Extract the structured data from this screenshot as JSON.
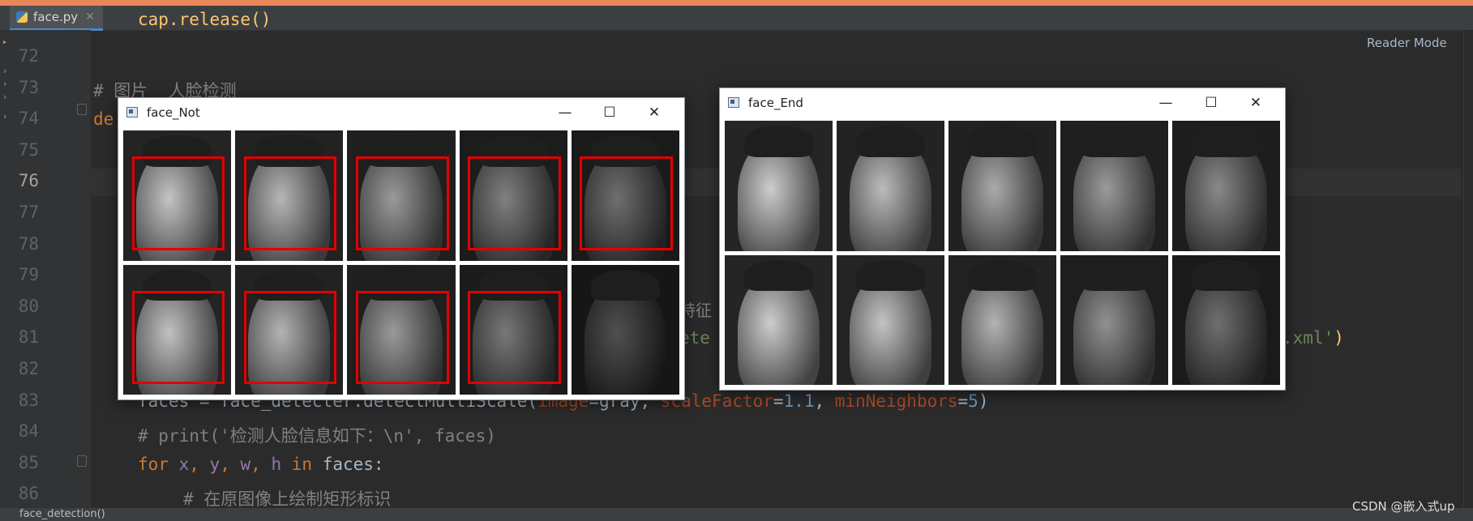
{
  "tab": {
    "filename": "face.py"
  },
  "reader_mode": "Reader Mode",
  "gutter": {
    "line_numbers": [
      "72",
      "73",
      "74",
      "75",
      "76",
      "77",
      "78",
      "79",
      "80",
      "81",
      "82",
      "83",
      "84",
      "85",
      "86"
    ],
    "active_line": "76"
  },
  "code": {
    "top_partial": "cap.release()",
    "l73": "# 图片  人脸检测",
    "l74": "de",
    "l80_tail": "特征",
    "l81_mid": "ete",
    "l81_tail": ".xml')",
    "l83": {
      "part1": "faces = face_detecter.detectMultiScale(",
      "param1": "image",
      "eq1": "=gray, ",
      "param2": "scaleFactor",
      "eq2": "=",
      "num1": "1.1",
      "sep": ", ",
      "param3": "minNeighbors",
      "eq3": "=",
      "num2": "5",
      "close": ")"
    },
    "l84": "# print('检测人脸信息如下：\\n', faces)",
    "l85": {
      "kw_for": "for",
      "x": "x",
      "c1": ", ",
      "y": "y",
      "c2": ", ",
      "w": "w",
      "c3": ", ",
      "h": "h",
      "kw_in": " in ",
      "rest": "faces:"
    },
    "l86": "# 在原图像上绘制矩形标识"
  },
  "window_not": {
    "title": "face_Not",
    "minimize": "—",
    "maximize": "☐",
    "close": "✕",
    "detected": [
      true,
      true,
      true,
      true,
      true,
      true,
      true,
      true,
      true,
      false
    ],
    "brightness": [
      0.8,
      0.72,
      0.55,
      0.4,
      0.3,
      0.78,
      0.7,
      0.55,
      0.35,
      0.12
    ]
  },
  "window_end": {
    "title": "face_End",
    "minimize": "—",
    "maximize": "☐",
    "close": "✕",
    "brightness": [
      0.85,
      0.75,
      0.65,
      0.55,
      0.45,
      0.85,
      0.8,
      0.7,
      0.5,
      0.3
    ]
  },
  "status": {
    "breadcrumb": "face_detection()"
  },
  "watermark": "CSDN @嵌入式up"
}
